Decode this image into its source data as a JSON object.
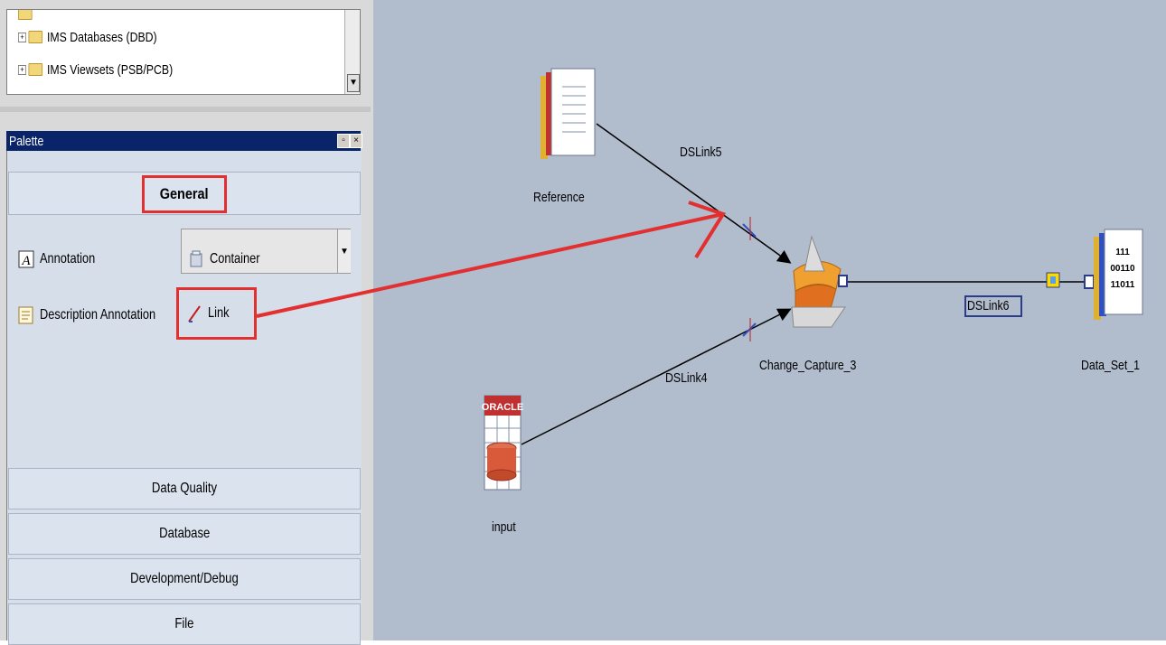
{
  "repository": {
    "tree_items": [
      {
        "label": "IMS Databases (DBD)"
      },
      {
        "label": "IMS Viewsets (PSB/PCB)"
      }
    ]
  },
  "palette": {
    "title": "Palette",
    "groups": {
      "general": "General",
      "data_quality": "Data Quality",
      "database": "Database",
      "development_debug": "Development/Debug",
      "file": "File"
    },
    "items": {
      "annotation": "Annotation",
      "description_annotation": "Description Annotation",
      "container": "Container",
      "link": "Link"
    }
  },
  "canvas": {
    "stages": {
      "reference": "Reference",
      "change_capture": "Change_Capture_3",
      "data_set": "Data_Set_1",
      "input": "input",
      "oracle_badge": "ORACLE",
      "data_set_bits": [
        "111",
        "00110",
        "11011"
      ]
    },
    "links": {
      "link5": "DSLink5",
      "link4": "DSLink4",
      "link6": "DSLink6"
    }
  },
  "colors": {
    "canvas_bg": "#b1bccd",
    "highlight_red": "#e23030",
    "title_bar": "#0a246a"
  }
}
